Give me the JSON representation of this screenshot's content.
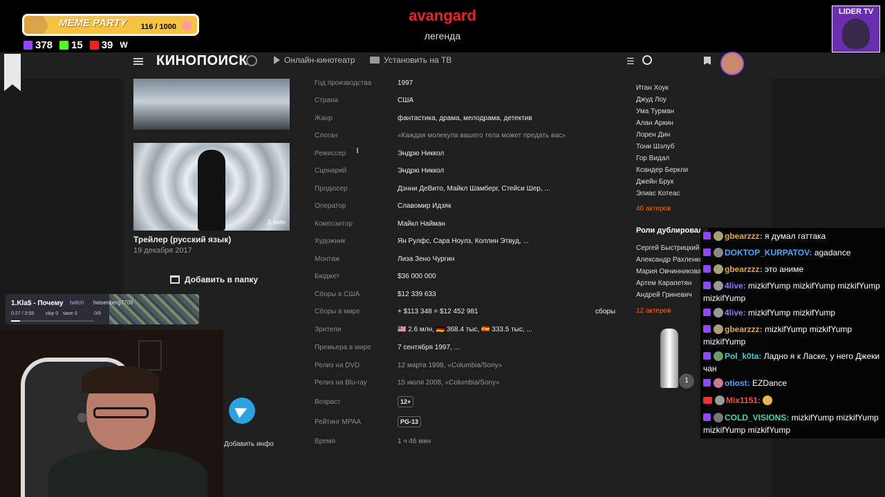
{
  "stream": {
    "meme_party": {
      "title": "MEME PARTY",
      "counter": "116 / 1000",
      "progress": 0.116
    },
    "stats": {
      "twitch": "378",
      "kick": "15",
      "live": "39",
      "w": "W"
    },
    "title": "avangard",
    "subtitle": "легенда",
    "lider_label": "LIDER TV"
  },
  "header": {
    "logo": "КИНОПОИСК",
    "nav": {
      "online": "Онлайн-кинотеатр",
      "tv": "Установить на ТВ"
    }
  },
  "trailer": {
    "duration": "3 мин",
    "title": "Трейлер (русский язык)",
    "date": "19 декабря 2017"
  },
  "add_folder": "Добавить в папку",
  "add_info": "Добавить инфо",
  "details": [
    {
      "label": "Год производства",
      "value": "1997"
    },
    {
      "label": "Страна",
      "value": "США"
    },
    {
      "label": "Жанр",
      "value": "фантастика, драма, мелодрама, детектив"
    },
    {
      "label": "Слоган",
      "value": "«Каждая молекула вашего тела может предать вас»"
    },
    {
      "label": "Режиссер",
      "value": "Эндрю Никкол"
    },
    {
      "label": "Сценарий",
      "value": "Эндрю Никкол"
    },
    {
      "label": "Продюсер",
      "value": "Дэнни ДеВито, Майкл Шамберг, Стейси Шер, ..."
    },
    {
      "label": "Оператор",
      "value": "Славомир Идзяк"
    },
    {
      "label": "Композитор",
      "value": "Майкл Найман"
    },
    {
      "label": "Художник",
      "value": "Ян Рулфс, Сара Ноулз, Коллин Этвуд, ..."
    },
    {
      "label": "Монтаж",
      "value": "Лиза Зено Чургин"
    },
    {
      "label": "Бюджет",
      "value": "$36 000 000"
    },
    {
      "label": "Сборы в США",
      "value": "$12 339 633"
    },
    {
      "label": "Сборы в мире",
      "value": "+ $113 348 = $12 452 981"
    },
    {
      "label": "Зрители",
      "value": "🇺🇸 2.6 млн, 🇩🇪 368.4 тыс, 🇪🇸 333.5 тыс, ..."
    },
    {
      "label": "Премьера в мире",
      "value": "7 сентября 1997, ..."
    },
    {
      "label": "Релиз на DVD",
      "value": "12 марта 1998, «Columbia/Sony»"
    },
    {
      "label": "Релиз на Blu-ray",
      "value": "15 июля 2008, «Columbia/Sony»"
    },
    {
      "label": "Возраст",
      "value": "12+"
    },
    {
      "label": "Рейтинг MPAA",
      "value": "PG-13"
    },
    {
      "label": "Время",
      "value": "1 ч 46 мин"
    }
  ],
  "sbory_link": "сборы",
  "actors": [
    "Итан Хоук",
    "Джуд Лоу",
    "Ума Турман",
    "Алан Аркин",
    "Лорен Дин",
    "Тони Шэлуб",
    "Гор Видал",
    "Ксандер Беркли",
    "Джейн Брук",
    "Элиас Котеас"
  ],
  "actors_count": "40 актеров",
  "dubbing_title": "Роли дублировали",
  "dubbing": [
    "Сергей Быстрицкий",
    "Александр Рахленко",
    "Мария Овчинникова",
    "Артем Карапетян",
    "Андрей Гриневич"
  ],
  "dubbing_count": "12 актеров",
  "oscar_count": "1",
  "music": {
    "title": "1.Kla$ - Почему",
    "source": "twitch",
    "user": "heisenberg7709",
    "time": "0:27 / 3:58",
    "skip": "skip 0",
    "save": "save 0",
    "votes": "0/9",
    "progress": 0.11
  },
  "chat": [
    {
      "platform": "twitch",
      "nick": "gbearzzz:",
      "text": "я думал гаттака",
      "color": "#e0a94a"
    },
    {
      "platform": "twitch",
      "nick": "DOKTOP_KURPATOV:",
      "text": "agadance",
      "color": "#4aa8ff"
    },
    {
      "platform": "twitch",
      "nick": "gbearzzz:",
      "text": "это аниме",
      "color": "#e0a94a"
    },
    {
      "platform": "twitch",
      "nick": "4live:",
      "text": "mizkifYump mizkifYump mizkifYump mizkifYump",
      "color": "#8a7cff"
    },
    {
      "platform": "twitch",
      "nick": "4live:",
      "text": "mizkifYump mizkifYump",
      "color": "#8a7cff"
    },
    {
      "platform": "twitch",
      "nick": "gbearzzz:",
      "text": "mizkifYump mizkifYump mizkifYump",
      "color": "#e0a94a"
    },
    {
      "platform": "twitch",
      "nick": "Pol_k0ta:",
      "text": "Ладно я к Ласке, у него Джеки чан",
      "color": "#3fd0c8"
    },
    {
      "platform": "twitch",
      "nick": "otiost:",
      "text": "EZDance",
      "color": "#4aa8ff"
    },
    {
      "platform": "live",
      "nick": "Mix1151:",
      "text": "",
      "color": "#ff4a4a"
    },
    {
      "platform": "twitch",
      "nick": "COLD_VISIONS:",
      "text": "mizkifYump mizkifYump mizkifYump mizkifYump",
      "color": "#4ad4a8"
    }
  ]
}
